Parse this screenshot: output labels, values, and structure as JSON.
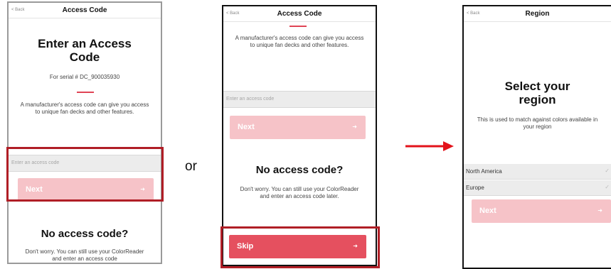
{
  "or_label": "or",
  "screen1": {
    "nav": {
      "back": "< Back",
      "title": "Access Code"
    },
    "heading": "Enter an Access Code",
    "serial": "For serial # DC_900035930",
    "description": "A manufacturer's access code can give you access to unique fan decks and other features.",
    "input_placeholder": "Enter an access code",
    "next_label": "Next",
    "no_code_heading": "No access code?",
    "no_code_text": "Don't worry. You can still use your ColorReader and enter an access code"
  },
  "screen2": {
    "nav": {
      "back": "< Back",
      "title": "Access Code"
    },
    "description": "A manufacturer's access code can give you access to unique fan decks and other features.",
    "input_placeholder": "Enter an access code",
    "next_label": "Next",
    "no_code_heading": "No access code?",
    "no_code_text": "Don't worry. You can still use your ColorReader and enter an access code later.",
    "skip_label": "Skip"
  },
  "screen3": {
    "nav": {
      "back": "< Back",
      "title": "Region"
    },
    "heading": "Select your region",
    "description": "This is used to match against colors available in your region",
    "regions": [
      "North America",
      "Europe"
    ],
    "next_label": "Next"
  },
  "colors": {
    "accent": "#e04455",
    "button_disabled": "#f6c3c8",
    "button_active": "#e5505f",
    "highlight": "#b01e26",
    "flow_arrow": "#e3131b"
  },
  "icons": {
    "back": "chevron-left-icon",
    "button": "arrow-right-icon",
    "row": "checkmark-icon",
    "flow": "flow-arrow-icon"
  }
}
